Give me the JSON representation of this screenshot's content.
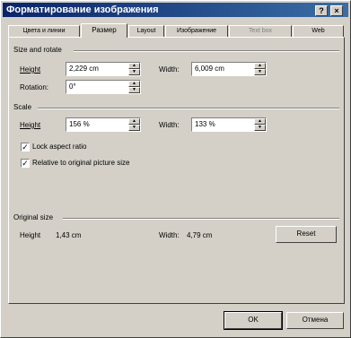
{
  "window": {
    "title": "Форматирование изображения",
    "help_btn": "?",
    "close_btn": "×"
  },
  "tabs": [
    {
      "label": "Цвета и линии"
    },
    {
      "label": "Размер"
    },
    {
      "label": "Layout"
    },
    {
      "label": "Изображение"
    },
    {
      "label": "Text box"
    },
    {
      "label": "Web"
    }
  ],
  "size_rotate": {
    "title": "Size and rotate",
    "height_label": "Height",
    "height_value": "2,229 cm",
    "width_label": "Width:",
    "width_value": "6,009 cm",
    "rotation_label": "Rotation:",
    "rotation_value": "0°"
  },
  "scale": {
    "title": "Scale",
    "height_label": "Height",
    "height_value": "156 %",
    "width_label": "Width:",
    "width_value": "133 %",
    "lock_aspect": {
      "label": "Lock aspect ratio",
      "checked": "✓"
    },
    "relative": {
      "label": "Relative to original picture size",
      "checked": "✓"
    }
  },
  "original": {
    "title": "Original size",
    "height_label": "Height",
    "height_value": "1,43 cm",
    "width_label": "Width:",
    "width_value": "4,79 cm",
    "reset": "Reset"
  },
  "buttons": {
    "ok": "OK",
    "cancel": "Отмена"
  }
}
